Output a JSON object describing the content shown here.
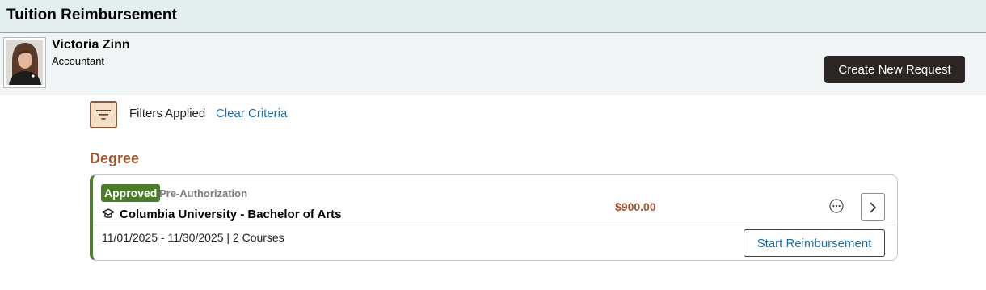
{
  "header": {
    "title": "Tuition Reimbursement"
  },
  "employee": {
    "name": "Victoria Zinn",
    "job_title": "Accountant"
  },
  "actions": {
    "create_label": "Create New Request"
  },
  "filters": {
    "applied_label": "Filters Applied",
    "clear_label": "Clear Criteria"
  },
  "section": {
    "title": "Degree"
  },
  "requests": [
    {
      "status": "Approved",
      "status_color": "#4a7d2a",
      "type": "Pre-Authorization",
      "course": "Columbia University - Bachelor of Arts",
      "amount": "$900.00",
      "date_range": "11/01/2025 - 11/30/2025 | 2 Courses",
      "action_label": "Start Reimbursement"
    }
  ],
  "colors": {
    "accent": "#9e5631",
    "link": "#1b6fa8",
    "primary_button": "#2b2623"
  },
  "icons": [
    "filter-icon",
    "graduation-cap-icon",
    "more-options-icon",
    "chevron-right-icon"
  ]
}
